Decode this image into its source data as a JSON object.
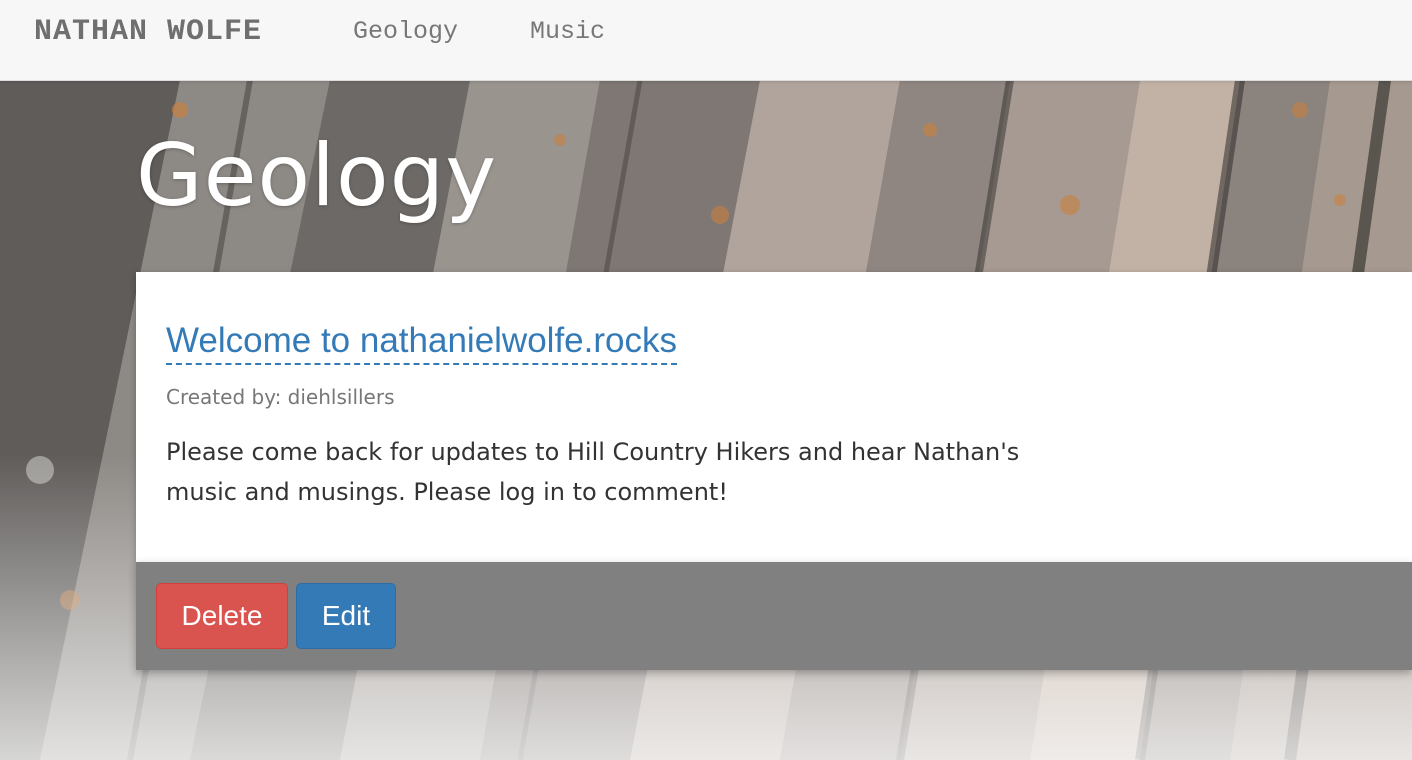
{
  "nav": {
    "brand": "NATHAN WOLFE",
    "links": [
      "Geology",
      "Music"
    ]
  },
  "page": {
    "title": "Geology"
  },
  "post": {
    "title": "Welcome to nathanielwolfe.rocks",
    "meta": "Created by: diehlsillers",
    "body": "Please come back for updates to Hill Country Hikers and hear Nathan's music and musings. Please log in to comment!"
  },
  "actions": {
    "delete_label": "Delete",
    "edit_label": "Edit"
  },
  "colors": {
    "link": "#337ab7",
    "delete": "#d9534f",
    "edit": "#337ab7",
    "action_bar": "#808080",
    "navbar": "#f7f7f7"
  }
}
